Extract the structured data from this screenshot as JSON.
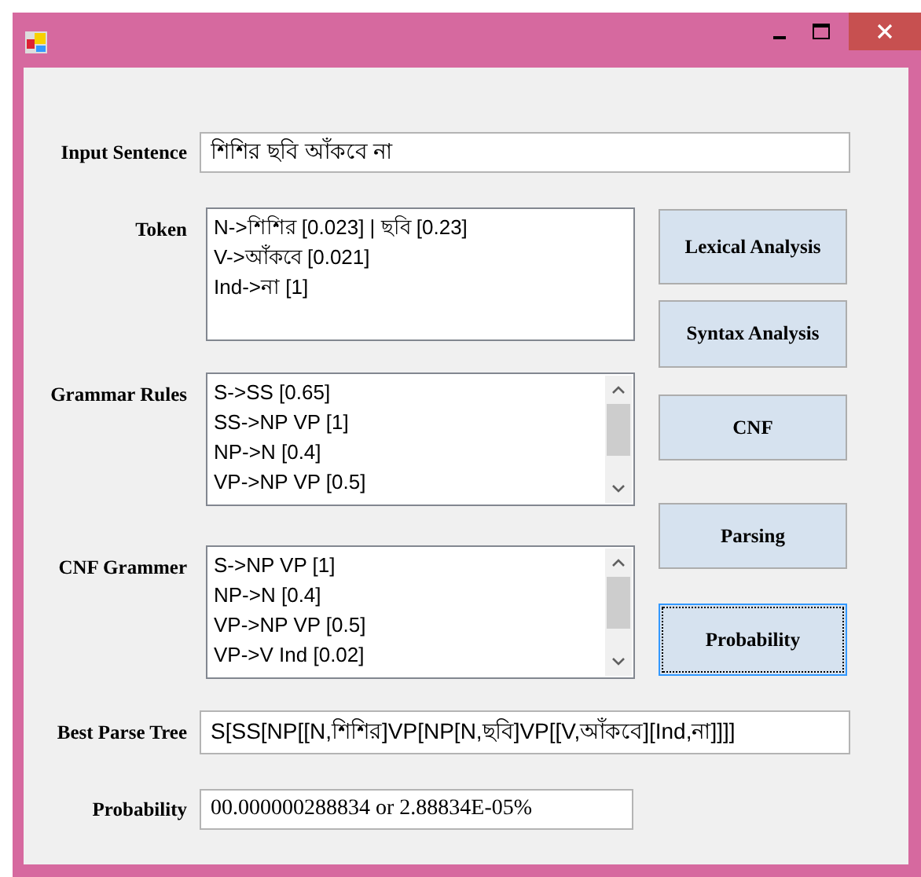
{
  "input_sentence": {
    "label": "Input Sentence",
    "value": "শিশির ছবি আঁকবে না"
  },
  "token": {
    "label": "Token",
    "lines": [
      "N->শিশির [0.023] | ছবি [0.23]",
      "V->আঁকবে [0.021]",
      "Ind->না [1]"
    ]
  },
  "grammar_rules": {
    "label": "Grammar Rules",
    "items": [
      "S->SS [0.65]",
      "SS->NP VP [1]",
      "NP->N [0.4]",
      "VP->NP VP [0.5]"
    ]
  },
  "cnf_grammar": {
    "label": "CNF Grammer",
    "items": [
      "S->NP VP [1]",
      "NP->N [0.4]",
      "VP->NP VP [0.5]",
      "VP->V Ind [0.02]"
    ]
  },
  "buttons": [
    {
      "label": "Lexical Analysis",
      "focused": false
    },
    {
      "label": "Syntax Analysis",
      "focused": false
    },
    {
      "label": "CNF",
      "focused": false
    },
    {
      "label": "Parsing",
      "focused": false
    },
    {
      "label": "Probability",
      "focused": true
    }
  ],
  "best_parse_tree": {
    "label": "Best Parse Tree",
    "value": "S[SS[NP[[N,শিশির]VP[NP[N,ছবি]VP[[V,আঁকবে][Ind,না]]]]"
  },
  "probability": {
    "label": "Probability",
    "value": "00.000000288834 or 2.88834E-05%"
  }
}
